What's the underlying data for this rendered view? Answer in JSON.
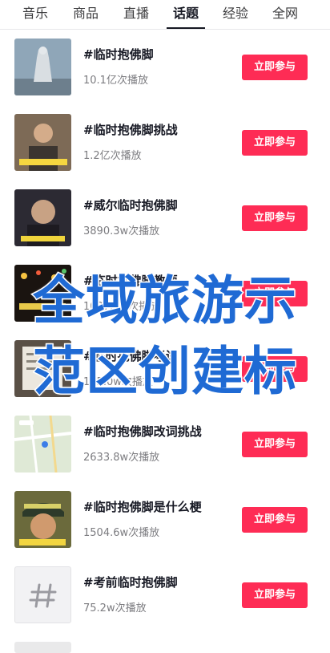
{
  "tabs": [
    {
      "label": "音乐",
      "active": false
    },
    {
      "label": "商品",
      "active": false
    },
    {
      "label": "直播",
      "active": false
    },
    {
      "label": "话题",
      "active": true
    },
    {
      "label": "经验",
      "active": false
    },
    {
      "label": "全网",
      "active": false
    }
  ],
  "topics": [
    {
      "title": "#临时抱佛脚",
      "plays": "10.1亿次播放",
      "button": "立即参与",
      "thumb": "buddha-statue"
    },
    {
      "title": "#临时抱佛脚挑战",
      "plays": "1.2亿次播放",
      "button": "立即参与",
      "thumb": "man-photo"
    },
    {
      "title": "#威尔临时抱佛脚",
      "plays": "3890.3w次播放",
      "button": "立即参与",
      "thumb": "singer-photo"
    },
    {
      "title": "#临时抱佛脚教师",
      "plays": "1037.0w次播放",
      "button": "立即参与",
      "thumb": "lights-photo"
    },
    {
      "title": "#临时抱佛脚考试",
      "plays": "155.0w次播放",
      "button": "立即参与",
      "thumb": "paper-photo"
    },
    {
      "title": "#临时抱佛脚改词挑战",
      "plays": "2633.8w次播放",
      "button": "立即参与",
      "thumb": "map-screenshot"
    },
    {
      "title": "#临时抱佛脚是什么梗",
      "plays": "1504.6w次播放",
      "button": "立即参与",
      "thumb": "cap-man-photo"
    },
    {
      "title": "#考前临时抱佛脚",
      "plays": "75.2w次播放",
      "button": "立即参与",
      "thumb": "hash-icon"
    }
  ],
  "watermark": {
    "line1": "全域旅游示",
    "line2": "范区创建标",
    "color": "#1f6ad4"
  },
  "colors": {
    "accent": "#fe2c55",
    "text": "#161823",
    "muted": "#7c7c80"
  }
}
